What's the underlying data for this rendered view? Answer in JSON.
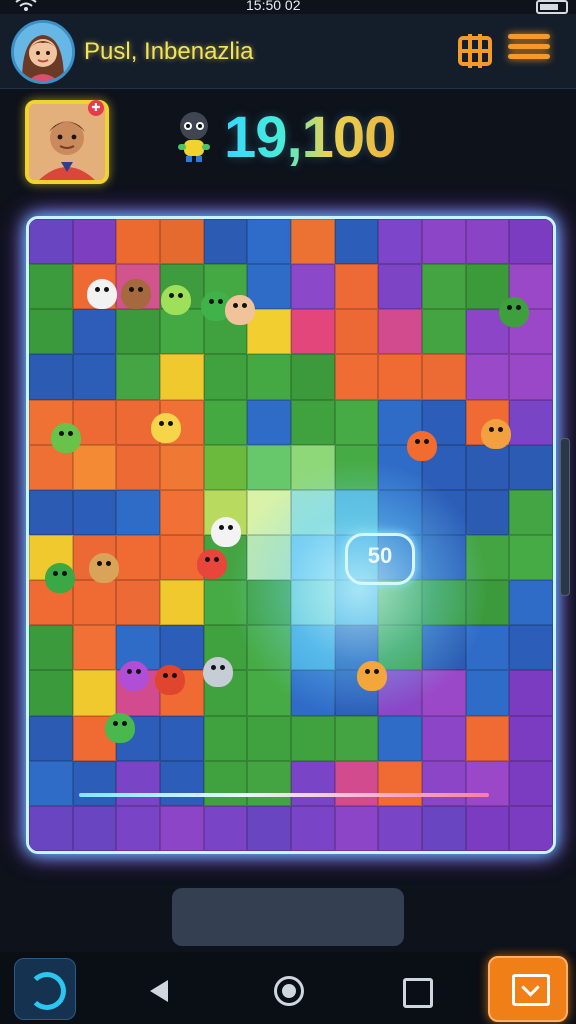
{
  "status_bar": {
    "time": "15:50 02"
  },
  "header": {
    "player_name": "Pusl, Inbenazlia"
  },
  "score": {
    "value": "19,100"
  },
  "board": {
    "columns": 12,
    "rows": 14,
    "bubble_value": "50",
    "tile_colors": [
      "#6a45c2",
      "#7d3fbf",
      "#ec6a30",
      "#e46a2f",
      "#2b5bb3",
      "#2f6bc8",
      "#ec7233",
      "#2c5db8",
      "#7d45c9",
      "#8b45c6",
      "#8a43c4",
      "#7c3cc1",
      "#3c9b3c",
      "#ef6a32",
      "#d2548c",
      "#3e9b3e",
      "#45a943",
      "#2f6cc7",
      "#8b48c9",
      "#ed6a36",
      "#7d44c6",
      "#45a442",
      "#3b9b3b",
      "#9b48c8",
      "#3a9a3c",
      "#2d5db8",
      "#3c9a3c",
      "#44a943",
      "#3fa23f",
      "#f2ce30",
      "#e2467a",
      "#ec6935",
      "#d34b8f",
      "#45a442",
      "#8b45c6",
      "#9b48c8",
      "#2b5bb2",
      "#2c5db7",
      "#45a443",
      "#f0c92e",
      "#3fa23f",
      "#44a943",
      "#3c9a3c",
      "#f06c35",
      "#ef6b33",
      "#ec6b34",
      "#9a4ac8",
      "#9a48c7",
      "#ef7133",
      "#ee6a34",
      "#ed6a35",
      "#f07035",
      "#45a942",
      "#2f6cc7",
      "#3fa23f",
      "#47ab45",
      "#2f6cc7",
      "#2c5db8",
      "#f06a33",
      "#7a44c7",
      "#ee7034",
      "#f58a34",
      "#ee6a34",
      "#ef7934",
      "#6bb93d",
      "#66c86a",
      "#8fd879",
      "#47ab45",
      "#2f6cc7",
      "#2c5db8",
      "#2b5bb2",
      "#2b5bb2",
      "#2b5bb2",
      "#2c5db8",
      "#2f6cc7",
      "#f07035",
      "#b8da5e",
      "#d9f2a8",
      "#9be1d4",
      "#55b7d8",
      "#2f6cc7",
      "#2c5db8",
      "#2b5bb2",
      "#43a543",
      "#f0c92e",
      "#ec6935",
      "#ef6b33",
      "#ef6b33",
      "#45a442",
      "#bde7b0",
      "#78c9ec",
      "#45a8e0",
      "#2f6cc7",
      "#2c5db8",
      "#45a442",
      "#47ab45",
      "#ef6b33",
      "#ef6b33",
      "#ec6a35",
      "#f0c92e",
      "#47ab45",
      "#3fa23f",
      "#7ad0d5",
      "#45a8e0",
      "#45a442",
      "#3b9b3b",
      "#3c9a3c",
      "#2f6cc7",
      "#3a9a3c",
      "#f07035",
      "#2f6cc7",
      "#2c5db8",
      "#3fa23f",
      "#47ab45",
      "#45a8e0",
      "#2c5db8",
      "#3fa23f",
      "#2b5bb2",
      "#2f6cc7",
      "#2c5db8",
      "#3a9a3c",
      "#f0c92e",
      "#d34b8f",
      "#ef6b33",
      "#3fa23f",
      "#47ab45",
      "#2f6cc7",
      "#2c5db8",
      "#8b45c6",
      "#9a48c7",
      "#2f6cc7",
      "#7c3cc1",
      "#2b5bb2",
      "#ef6b33",
      "#2c5db8",
      "#2c5db8",
      "#3fa23f",
      "#3fa23f",
      "#3fa23f",
      "#45a442",
      "#2f6cc7",
      "#8b45c6",
      "#ef6b33",
      "#7c3cc1",
      "#2f6cc7",
      "#2c5db8",
      "#7a44c7",
      "#2c5db8",
      "#3fa23f",
      "#45a442",
      "#7a44c7",
      "#d34b8f",
      "#ef6b33",
      "#8b45c6",
      "#9a48c7",
      "#7c3cc1",
      "#6a45c2",
      "#6a45c2",
      "#7a44c7",
      "#8b45c6",
      "#7a44c7",
      "#6a45c2",
      "#7a44c7",
      "#8b45c6",
      "#7a44c7",
      "#6a45c2",
      "#7c3cc1",
      "#7c3cc1"
    ],
    "critters": [
      {
        "name": "white-creature",
        "color": "#f2f2f2"
      },
      {
        "name": "brown-creature",
        "color": "#a5683f"
      },
      {
        "name": "green-alien",
        "color": "#9fe05a"
      },
      {
        "name": "green-leaf-creature",
        "color": "#3fb24a"
      },
      {
        "name": "boy-character",
        "color": "#f0c39a"
      },
      {
        "name": "yellow-bird",
        "color": "#f6d54a"
      },
      {
        "name": "orange-fox",
        "color": "#f26b2f"
      },
      {
        "name": "small-orange-creature",
        "color": "#f2a040"
      },
      {
        "name": "green-blob",
        "color": "#69c34a"
      },
      {
        "name": "white-ghost",
        "color": "#f3f3f3"
      },
      {
        "name": "red-creature",
        "color": "#e8463a"
      },
      {
        "name": "tan-cat",
        "color": "#d9a35a"
      },
      {
        "name": "green-sprout",
        "color": "#3aa845"
      },
      {
        "name": "green-bush",
        "color": "#3e9f3e"
      },
      {
        "name": "purple-slime",
        "color": "#b04ed8"
      },
      {
        "name": "red-spiky",
        "color": "#e0462e"
      },
      {
        "name": "grey-creature",
        "color": "#c7cdd6"
      },
      {
        "name": "orange-cat",
        "color": "#f2a63c"
      },
      {
        "name": "green-frog",
        "color": "#49b84f"
      }
    ]
  }
}
